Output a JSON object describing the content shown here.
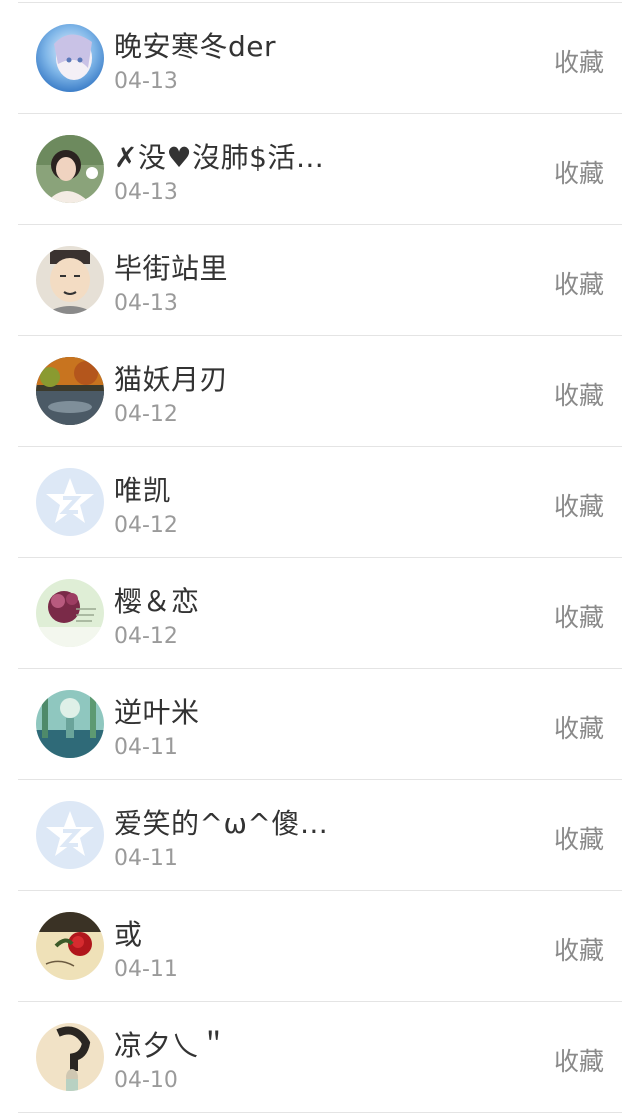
{
  "action_label": "收藏",
  "items": [
    {
      "name": "晚安寒冬der",
      "date": "04-13",
      "avatar": "anime-girl-avatar"
    },
    {
      "name": "✗没♥沒肺$活…",
      "date": "04-13",
      "avatar": "woman-photo-avatar"
    },
    {
      "name": "毕街站里",
      "date": "04-13",
      "avatar": "cartoon-man-avatar"
    },
    {
      "name": "猫妖月刃",
      "date": "04-12",
      "avatar": "landscape-avatar"
    },
    {
      "name": "唯凯",
      "date": "04-12",
      "avatar": "default-qzone-avatar"
    },
    {
      "name": "樱＆恋",
      "date": "04-12",
      "avatar": "flower-photo-avatar"
    },
    {
      "name": "逆叶米",
      "date": "04-11",
      "avatar": "teal-painting-avatar"
    },
    {
      "name": "爱笑的^ω^傻…",
      "date": "04-11",
      "avatar": "default-qzone-avatar"
    },
    {
      "name": "或",
      "date": "04-11",
      "avatar": "red-rose-avatar"
    },
    {
      "name": "凉夕乀＂",
      "date": "04-10",
      "avatar": "sketch-avatar"
    }
  ]
}
